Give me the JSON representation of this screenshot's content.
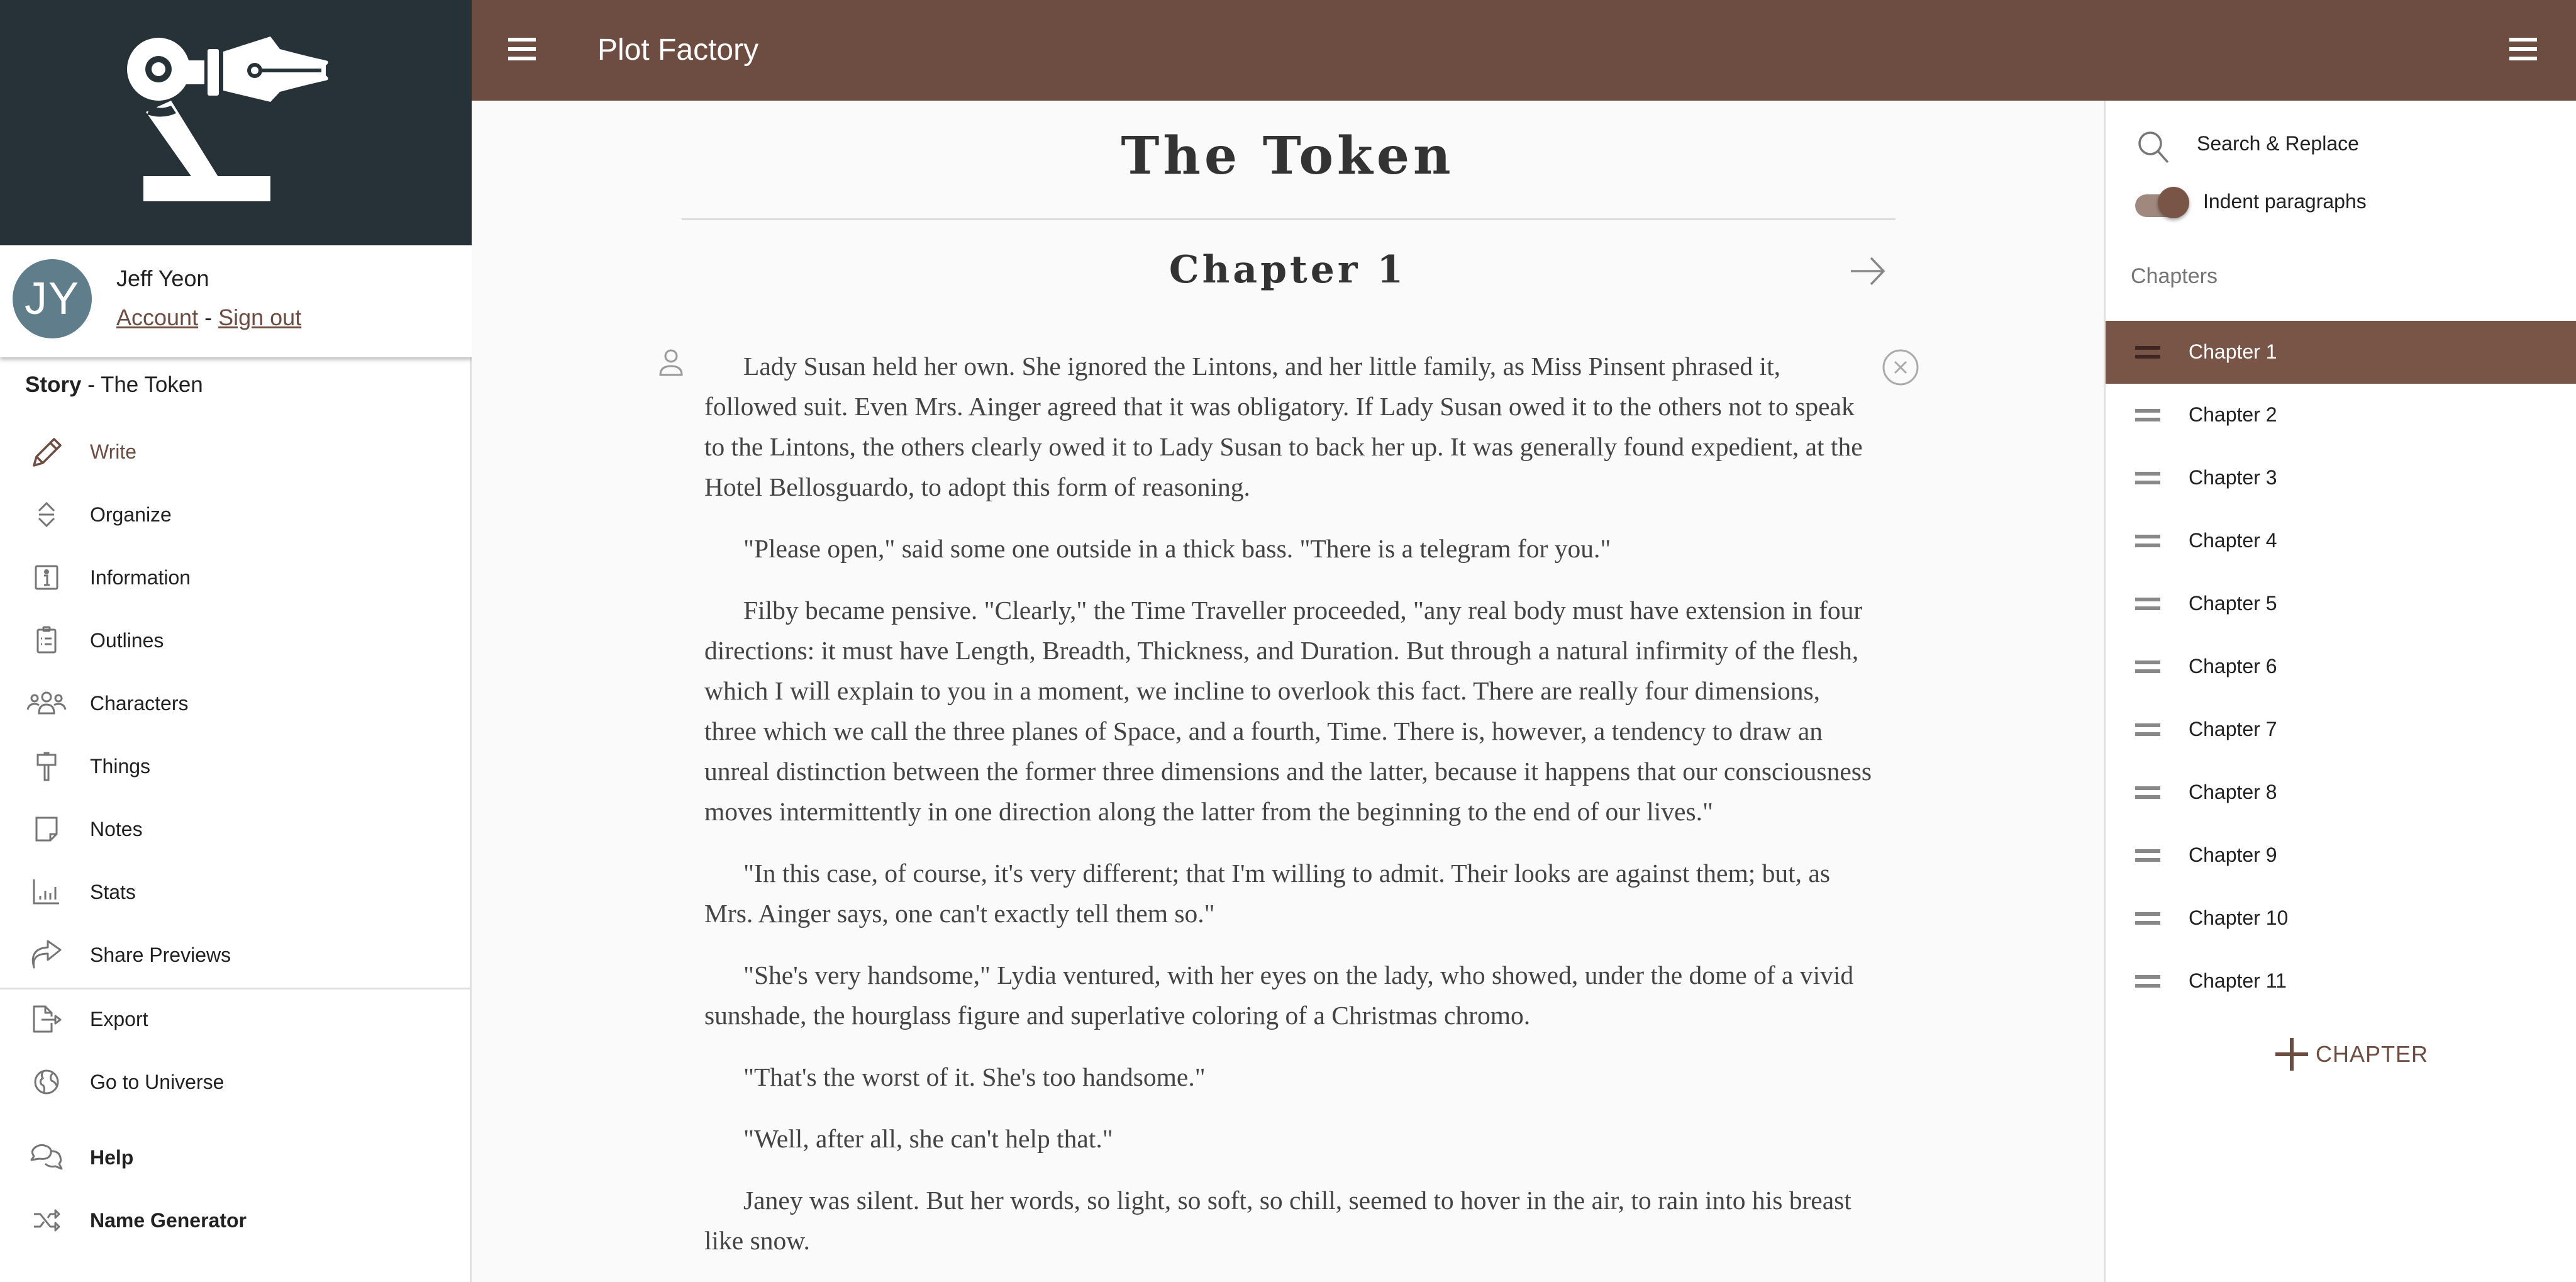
{
  "app": {
    "title": "Plot Factory",
    "brand_color": "#6D4C41",
    "sidebar_header_color": "#263238"
  },
  "user": {
    "initials": "JY",
    "name": "Jeff Yeon",
    "account_link": "Account",
    "separator": "-",
    "signout_link": "Sign out"
  },
  "story": {
    "label": "Story",
    "separator": " - ",
    "name": "The Token"
  },
  "sidebar": {
    "items": [
      {
        "label": "Write",
        "icon": "pencil-icon",
        "active": true
      },
      {
        "label": "Organize",
        "icon": "sort-icon"
      },
      {
        "label": "Information",
        "icon": "info-icon"
      },
      {
        "label": "Outlines",
        "icon": "clipboard-list-icon"
      },
      {
        "label": "Characters",
        "icon": "people-icon"
      },
      {
        "label": "Things",
        "icon": "hammer-icon"
      },
      {
        "label": "Notes",
        "icon": "note-icon"
      },
      {
        "label": "Stats",
        "icon": "bar-chart-icon"
      },
      {
        "label": "Share Previews",
        "icon": "share-icon"
      },
      {
        "label": "Export",
        "icon": "export-file-icon"
      },
      {
        "label": "Go to Universe",
        "icon": "globe-icon"
      },
      {
        "label": "Help",
        "icon": "chat-bubbles-icon"
      },
      {
        "label": "Name Generator",
        "icon": "shuffle-icon"
      }
    ]
  },
  "editor": {
    "story_title": "The Token",
    "chapter_title": "Chapter 1",
    "paragraphs": [
      "Lady Susan held her own. She ignored the Lintons, and her little family, as Miss Pinsent phrased it, followed suit. Even Mrs. Ainger agreed that it was obligatory. If Lady Susan owed it to the others not to speak to the Lintons, the others clearly owed it to Lady Susan to back her up. It was generally found expedient, at the Hotel Bellosguardo, to adopt this form of reasoning.",
      "\"Please open,\" said some one outside in a thick bass. \"There is a telegram for you.\"",
      "Filby became pensive. \"Clearly,\" the Time Traveller proceeded, \"any real body must have extension in four directions: it must have Length, Breadth, Thickness, and Duration. But through a natural infirmity of the flesh, which I will explain to you in a moment, we incline to overlook this fact. There are really four dimensions, three which we call the three planes of Space, and a fourth, Time. There is, however, a tendency to draw an unreal distinction between the former three dimensions and the latter, because it happens that our consciousness moves intermittently in one direction along the latter from the beginning to the end of our lives.\"",
      "\"In this case, of course, it's very different; that I'm willing to admit. Their looks are against them; but, as Mrs. Ainger says, one can't exactly tell them so.\"",
      "\"She's very handsome,\" Lydia ventured, with her eyes on the lady, who showed, under the dome of a vivid sunshade, the hourglass figure and superlative coloring of a Christmas chromo.",
      "\"That's the worst of it. She's too handsome.\"",
      "\"Well, after all, she can't help that.\"",
      "Janey was silent. But her words, so light, so soft, so chill, seemed to hover in the air, to rain into his breast like snow."
    ]
  },
  "right_panel": {
    "search_replace_label": "Search & Replace",
    "indent_toggle_label": "Indent paragraphs",
    "indent_toggle_on": true,
    "chapters_heading": "Chapters",
    "chapters": [
      {
        "label": "Chapter 1",
        "active": true
      },
      {
        "label": "Chapter 2"
      },
      {
        "label": "Chapter 3"
      },
      {
        "label": "Chapter 4"
      },
      {
        "label": "Chapter 5"
      },
      {
        "label": "Chapter 6"
      },
      {
        "label": "Chapter 7"
      },
      {
        "label": "Chapter 8"
      },
      {
        "label": "Chapter 9"
      },
      {
        "label": "Chapter 10"
      },
      {
        "label": "Chapter 11"
      }
    ],
    "add_chapter_label": "CHAPTER"
  }
}
